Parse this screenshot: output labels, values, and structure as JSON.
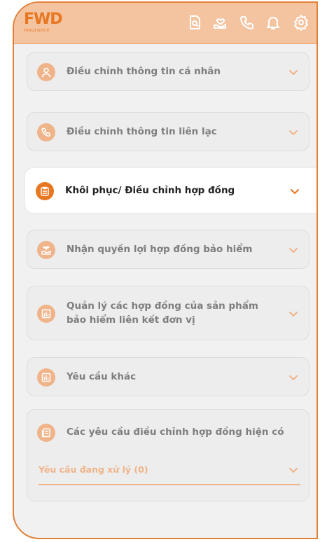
{
  "brand": {
    "logo_main": "FWD",
    "logo_sub": "insurance"
  },
  "header": {
    "icons": [
      "document-search-icon",
      "hand-heart-icon",
      "phone-icon",
      "bell-icon",
      "gear-icon"
    ]
  },
  "menu": {
    "items": [
      {
        "label": "Điều chỉnh thông tin cá nhân",
        "icon": "user-icon"
      },
      {
        "label": "Điều chỉnh thông tin liên lạc",
        "icon": "phone-icon"
      },
      {
        "label": "Khôi phục/ Điều chỉnh hợp đồng",
        "icon": "clipboard-icon",
        "active": true
      },
      {
        "label": "Nhận quyền lợi hợp đồng bảo hiểm",
        "icon": "hand-sprout-icon"
      },
      {
        "label_line1": "Quản lý các hợp đồng của sản phẩm",
        "label_line2": "bảo hiểm liên kết đơn vị",
        "icon": "chart-icon"
      },
      {
        "label": "Yêu cầu khác",
        "icon": "chart-icon"
      }
    ],
    "existing": {
      "label": "Các yêu cầu điều chỉnh hợp đồng hiện có",
      "icon": "documents-icon",
      "pending_label": "Yêu cầu đang xử lý (0)"
    }
  },
  "colors": {
    "accent": "#e87722",
    "accent_light": "#f0b48a",
    "header_bg": "#f4c4a1",
    "page_bg": "#f1f1f1"
  }
}
